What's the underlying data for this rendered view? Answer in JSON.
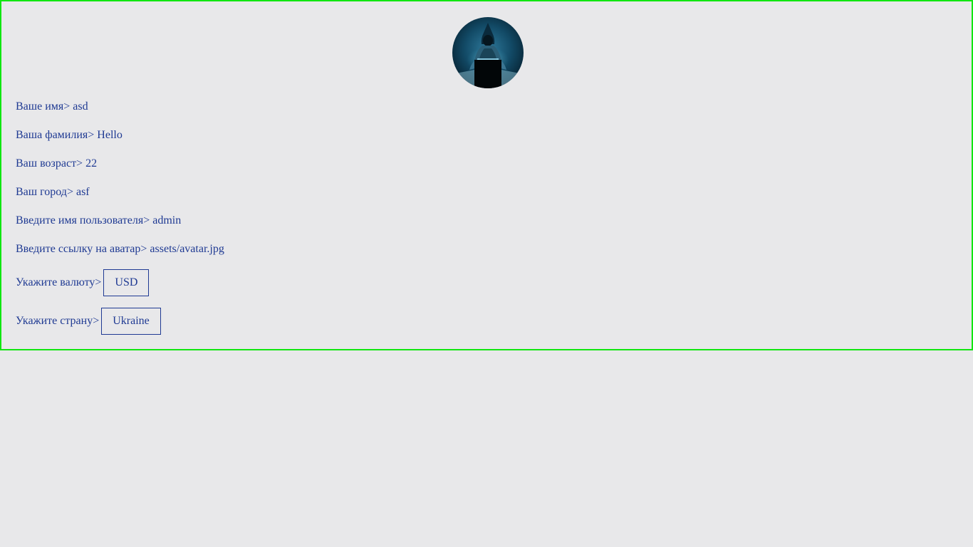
{
  "avatar": {
    "icon": "hooded-hacker-avatar-icon"
  },
  "profile": {
    "first_name_label": "Ваше имя>",
    "first_name_value": "asd",
    "last_name_label": "Ваша фамилия>",
    "last_name_value": "Hello",
    "age_label": "Ваш возраст>",
    "age_value": "22",
    "city_label": "Ваш город>",
    "city_value": "asf",
    "username_label": "Введите имя пользователя>",
    "username_value": "admin",
    "avatar_link_label": "Введите ссылку на аватар>",
    "avatar_link_value": "assets/avatar.jpg",
    "currency_label": "Укажите валюту>",
    "currency_value": "USD",
    "country_label": "Укажите страну>",
    "country_value": "Ukraine"
  },
  "colors": {
    "background": "#e8e8ea",
    "border": "#11e611",
    "text": "#1f3a93"
  }
}
